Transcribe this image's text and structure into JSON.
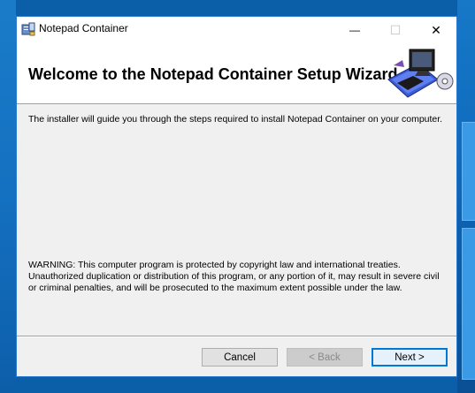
{
  "window": {
    "title": "Notepad Container",
    "minimize_glyph": "—",
    "maximize_glyph": "☐",
    "close_glyph": "✕"
  },
  "banner": {
    "heading": "Welcome to the Notepad Container Setup Wizard",
    "art_icon": "computer-cd-icon"
  },
  "content": {
    "intro": "The installer will guide you through the steps required to install Notepad Container on your computer.",
    "warning": "WARNING: This computer program is protected by copyright law and international treaties. Unauthorized duplication or distribution of this program, or any portion of it, may result in severe civil or criminal penalties, and will be prosecuted to the maximum extent possible under the law."
  },
  "buttons": {
    "cancel": "Cancel",
    "back": "< Back",
    "next": "Next >"
  },
  "colors": {
    "desktop": "#0b5fa8",
    "window_border": "#2b7ad0",
    "default_button": "#0078d7"
  }
}
